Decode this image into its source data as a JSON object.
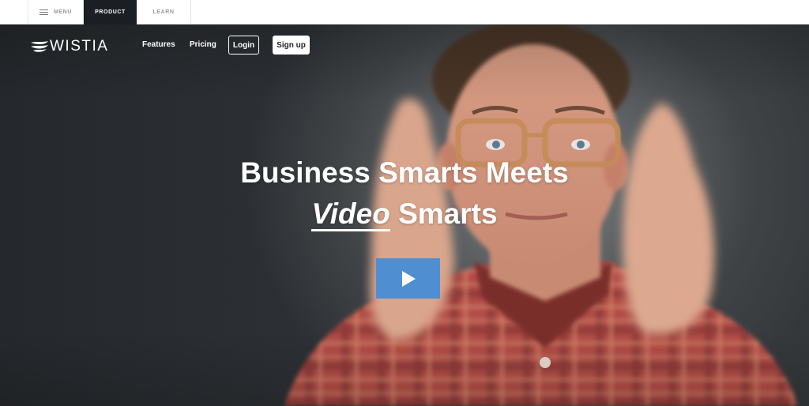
{
  "topbar": {
    "tabs": [
      {
        "label": "MENU",
        "icon": "hamburger-icon"
      },
      {
        "label": "PRODUCT",
        "active": true
      },
      {
        "label": "LEARN"
      }
    ]
  },
  "nav": {
    "logo_text": "WISTIA",
    "logo_icon": "wistia-logo-icon",
    "features": "Features",
    "pricing": "Pricing",
    "login": "Login",
    "signup": "Sign up"
  },
  "hero": {
    "headline_line1": "Business Smarts Meets",
    "headline_em": "Video",
    "headline_line2_rest": "Smarts",
    "play_icon": "play-icon",
    "play_color": "#4a8fd4"
  }
}
